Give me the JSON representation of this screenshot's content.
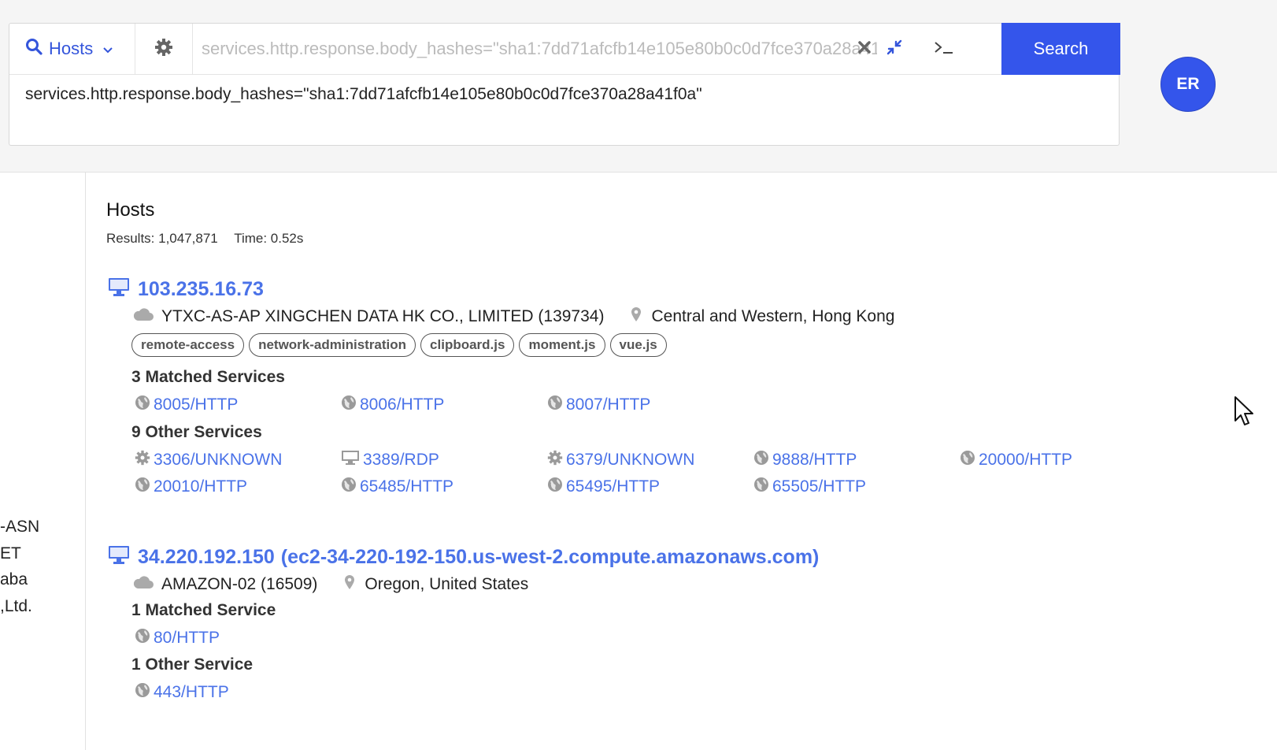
{
  "search": {
    "type_label": "Hosts",
    "placeholder": "services.http.response.body_hashes=\"sha1:7dd71afcfb14e105e80b0c0d7fce370a28a41f0a\"",
    "expanded_query": "services.http.response.body_hashes=\"sha1:7dd71afcfb14e105e80b0c0d7fce370a28a41f0a\"",
    "button_label": "Search",
    "icons": [
      "search-icon",
      "chevron-down-icon",
      "gear-icon",
      "clear-icon",
      "collapse-icon",
      "terminal-icon"
    ]
  },
  "user": {
    "initials": "ER"
  },
  "left_panel": {
    "fragments": [
      "-ASN",
      "ET",
      "aba",
      ",Ltd."
    ]
  },
  "results": {
    "title": "Hosts",
    "count_text": "Results: 1,047,871",
    "time_text": "Time: 0.52s"
  },
  "hosts": [
    {
      "ip": "103.235.16.73",
      "asn": "YTXC-AS-AP XINGCHEN DATA HK CO., LIMITED (139734)",
      "location": "Central and Western, Hong Kong",
      "tags": [
        "remote-access",
        "network-administration",
        "clipboard.js",
        "moment.js",
        "vue.js"
      ],
      "matched_heading": "3 Matched Services",
      "matched": [
        {
          "label": "8005/HTTP",
          "icon": "globe"
        },
        {
          "label": "8006/HTTP",
          "icon": "globe"
        },
        {
          "label": "8007/HTTP",
          "icon": "globe"
        }
      ],
      "other_heading": "9 Other Services",
      "other": [
        {
          "label": "3306/UNKNOWN",
          "icon": "gear"
        },
        {
          "label": "3389/RDP",
          "icon": "monitor"
        },
        {
          "label": "6379/UNKNOWN",
          "icon": "gear"
        },
        {
          "label": "9888/HTTP",
          "icon": "globe"
        },
        {
          "label": "20000/HTTP",
          "icon": "globe"
        },
        {
          "label": "20010/HTTP",
          "icon": "globe"
        },
        {
          "label": "65485/HTTP",
          "icon": "globe"
        },
        {
          "label": "65495/HTTP",
          "icon": "globe"
        },
        {
          "label": "65505/HTTP",
          "icon": "globe"
        }
      ]
    },
    {
      "ip": "34.220.192.150",
      "dns": "(ec2-34-220-192-150.us-west-2.compute.amazonaws.com)",
      "asn": "AMAZON-02 (16509)",
      "location": "Oregon, United States",
      "matched_heading": "1 Matched Service",
      "matched": [
        {
          "label": "80/HTTP",
          "icon": "globe"
        }
      ],
      "other_heading": "1 Other Service",
      "other": [
        {
          "label": "443/HTTP",
          "icon": "globe"
        }
      ]
    }
  ],
  "colors": {
    "accent": "#3455eb",
    "link": "#4a72e8",
    "icon_gray": "#9a9a9a"
  }
}
